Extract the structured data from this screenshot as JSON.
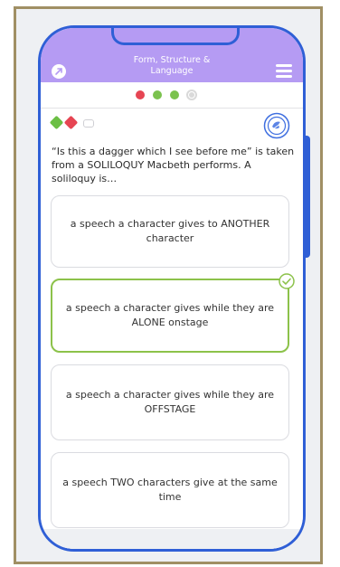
{
  "header": {
    "title_line1": "Form, Structure &",
    "title_line2": "Language"
  },
  "progress": {
    "dots": [
      {
        "state": "wrong",
        "color": "#e64553"
      },
      {
        "state": "correct",
        "color": "#7bc24e"
      },
      {
        "state": "correct",
        "color": "#7bc24e"
      },
      {
        "state": "current",
        "color": "#d9d9d9"
      }
    ]
  },
  "lives": {
    "colors": [
      "#6cbf45",
      "#e64553"
    ],
    "empty_slots": 1
  },
  "hint": {
    "icon": "hint-badge-icon"
  },
  "question": {
    "text": "“Is this a dagger which I see before me” is taken from a SOLILOQUY Macbeth performs. A soliloquy is…"
  },
  "options": [
    {
      "text": "a speech a character gives to ANOTHER character",
      "selected": false
    },
    {
      "text": "a speech a character gives while they are ALONE onstage",
      "selected": true
    },
    {
      "text": "a speech a character gives while they are OFFSTAGE",
      "selected": false
    },
    {
      "text": "a speech TWO characters give at the same time",
      "selected": false
    }
  ],
  "colors": {
    "header_bg": "#b59bf3",
    "phone_border": "#2f5fd6",
    "selected_border": "#8cc24a"
  }
}
